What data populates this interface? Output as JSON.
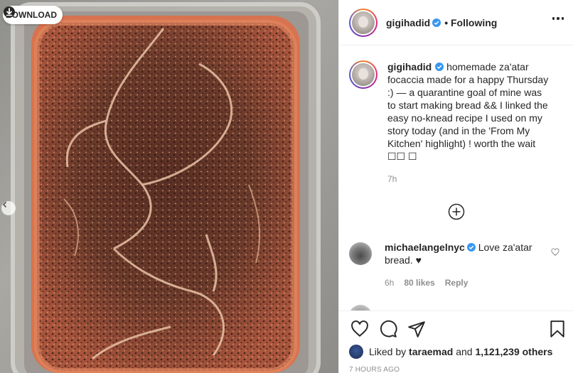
{
  "photo": {
    "download_label": "DOWNLOAD"
  },
  "post": {
    "username": "gigihadid",
    "follow_status": "• Following",
    "caption_user": "gigihadid",
    "caption_text": "homemade za'atar focaccia made for a happy Thursday :) — a quarantine goal of mine was to start making bread && I linked the easy no-knead recipe I used on my story today (and in the 'From My Kitchen' highlight) ! worth the wait ☐☐ ☐",
    "caption_time": "7h"
  },
  "comment": {
    "username": "michaelangelnyc",
    "text": "Love za'atar bread. ♥",
    "time": "6h",
    "likes": "80 likes",
    "reply": "Reply"
  },
  "likes": {
    "prefix": "Liked by",
    "user": "taraemad",
    "connector": "and",
    "others": "1,121,239 others"
  },
  "timestamp": "7 HOURS AGO",
  "icons": [
    "download-icon",
    "verified-icon",
    "more-icon",
    "add-comment-icon",
    "heart-icon",
    "comment-icon",
    "share-icon",
    "bookmark-icon"
  ]
}
